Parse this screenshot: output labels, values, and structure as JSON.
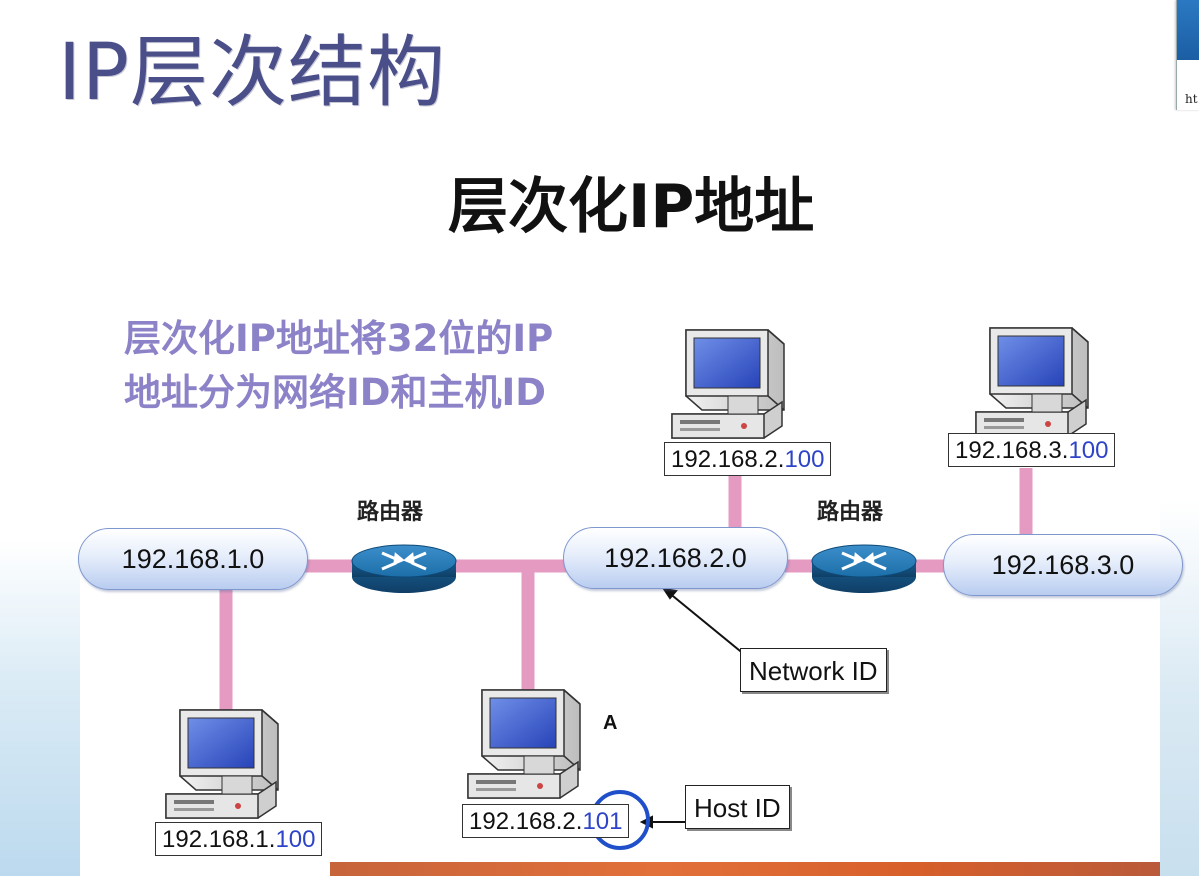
{
  "slide": {
    "title": "IP层次结构",
    "heading": "层次化IP地址",
    "description_line1": "层次化IP地址将32位的IP",
    "description_line2": "地址分为网络ID和主机ID",
    "corner_text": "ht"
  },
  "diagram": {
    "router_label": "路由器",
    "networks": [
      "192.168.1.0",
      "192.168.2.0",
      "192.168.3.0"
    ],
    "hosts": [
      {
        "network_part": "192.168.1.",
        "host_part": "100"
      },
      {
        "network_part": "192.168.2.",
        "host_part": "100"
      },
      {
        "network_part": "192.168.2.",
        "host_part": "101"
      },
      {
        "network_part": "192.168.3.",
        "host_part": "100"
      }
    ],
    "host_a_label": "A",
    "network_id_label": "Network ID",
    "host_id_label": "Host ID"
  },
  "colors": {
    "title": "#4a4f8a",
    "description": "#8b82c8",
    "link": "#e59ac2",
    "host_id": "#2d44c8",
    "highlight_circle": "#1f4fc9",
    "router": "#1c6fa8"
  }
}
